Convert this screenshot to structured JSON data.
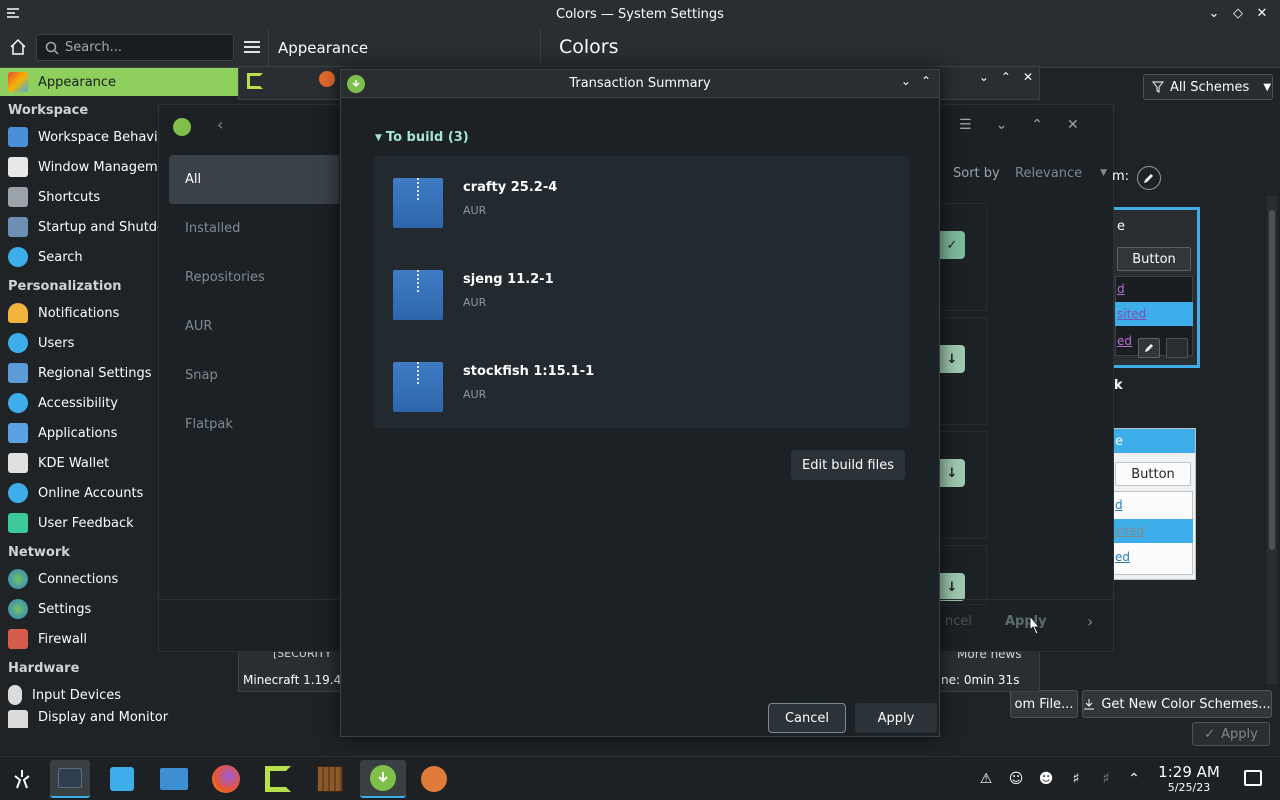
{
  "window": {
    "title": "Colors — System Settings"
  },
  "toolbar": {
    "search_placeholder": "Search...",
    "breadcrumb_1": "Appearance",
    "breadcrumb_2": "Colors"
  },
  "sidebar": {
    "active_item": "Appearance",
    "categories": [
      {
        "label": "Workspace",
        "items": [
          "Workspace Behavior",
          "Window Management",
          "Shortcuts",
          "Startup and Shutdown",
          "Search"
        ]
      },
      {
        "label": "Personalization",
        "items": [
          "Notifications",
          "Users",
          "Regional Settings",
          "Accessibility",
          "Applications",
          "KDE Wallet",
          "Online Accounts",
          "User Feedback"
        ]
      },
      {
        "label": "Network",
        "items": [
          "Connections",
          "Settings",
          "Firewall"
        ]
      },
      {
        "label": "Hardware",
        "items": [
          "Input Devices",
          "Display and Monitor"
        ]
      }
    ]
  },
  "colors_page": {
    "filter_label": "All Schemes",
    "preview_button": "Button",
    "preview_links": [
      "d",
      "sited",
      "ed"
    ],
    "preview_title_fragment": "e",
    "preview_heading_fragment": "k",
    "from_file_label": "om File...",
    "get_new_label": "Get New Color Schemes...",
    "apply_label": "Apply"
  },
  "pamac": {
    "nav_items": [
      "All",
      "Installed",
      "Repositories",
      "AUR",
      "Snap",
      "Flatpak"
    ],
    "sort_by_label": "Sort by",
    "sort_value": "Relevance",
    "footer_cancel": "ncel",
    "footer_apply": "Apply",
    "partial_label": "m:"
  },
  "minecraft": {
    "version_text": "Minecraft 1.19.4",
    "security_text": "[SECURITY",
    "more_news": "More news",
    "time_text": "ne: 0min 31s"
  },
  "dialog": {
    "title": "Transaction Summary",
    "section_header": "To build (3)",
    "packages": [
      {
        "name": "crafty  25.2-4",
        "repo": "AUR"
      },
      {
        "name": "sjeng  11.2-1",
        "repo": "AUR"
      },
      {
        "name": "stockfish  1:15.1-1",
        "repo": "AUR"
      }
    ],
    "edit_button": "Edit build files",
    "cancel_button": "Cancel",
    "apply_button": "Apply"
  },
  "taskbar": {
    "time": "1:29 AM",
    "date": "5/25/23"
  },
  "colors": {
    "accent_green": "#8ecf5d",
    "accent_blue": "#3daee9",
    "dialog_bg": "#1c2126"
  }
}
